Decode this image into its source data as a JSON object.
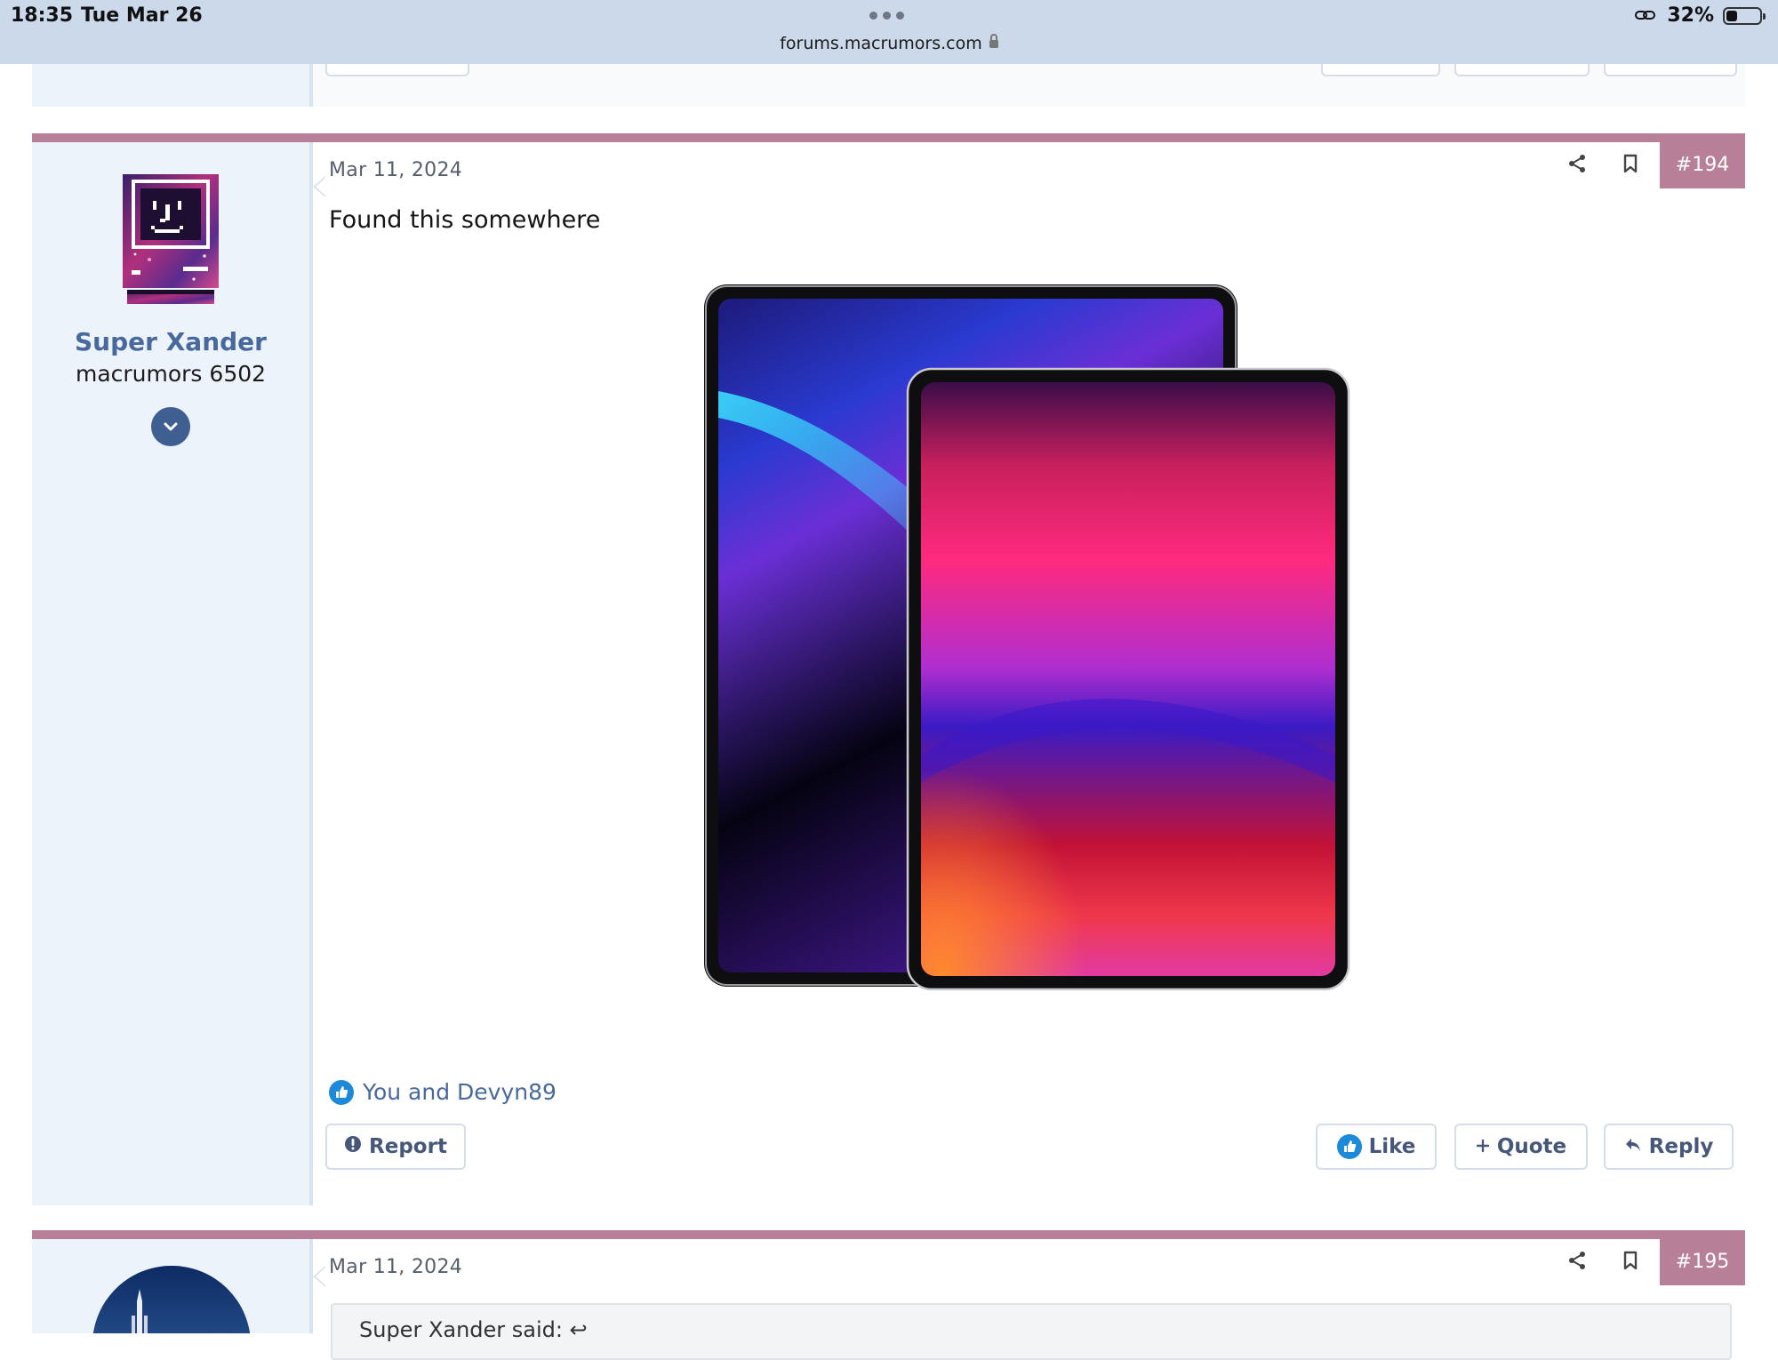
{
  "status_bar": {
    "time": "18:35",
    "date": "Tue Mar 26",
    "url": "forums.macrumors.com",
    "battery": "32%",
    "battery_fraction": 0.32
  },
  "colors": {
    "post_accent": "#b88098",
    "author_bg": "#edf3fb",
    "link": "#47699e",
    "button_text": "#47577a",
    "like_blue": "#1c8ad8"
  },
  "posts": [
    {
      "number": "#194",
      "date": "Mar 11, 2024",
      "author": {
        "name": "Super Xander",
        "title": "macrumors 6502",
        "avatar": "smiling-mac-avatar-icon"
      },
      "body": "Found this somewhere",
      "image": {
        "description": "ipad-pair-image",
        "left_color": "#2b1b8e",
        "right_color": "#e02b6b"
      },
      "reactions": "You and Devyn89",
      "actions": {
        "report": "Report",
        "like": "Like",
        "quote": "Quote",
        "reply": "Reply"
      }
    },
    {
      "number": "#195",
      "date": "Mar 11, 2024",
      "author": {
        "avatar": "rocket-launch-avatar-icon"
      },
      "quote_partial": "Super Xander said: ↩"
    }
  ]
}
